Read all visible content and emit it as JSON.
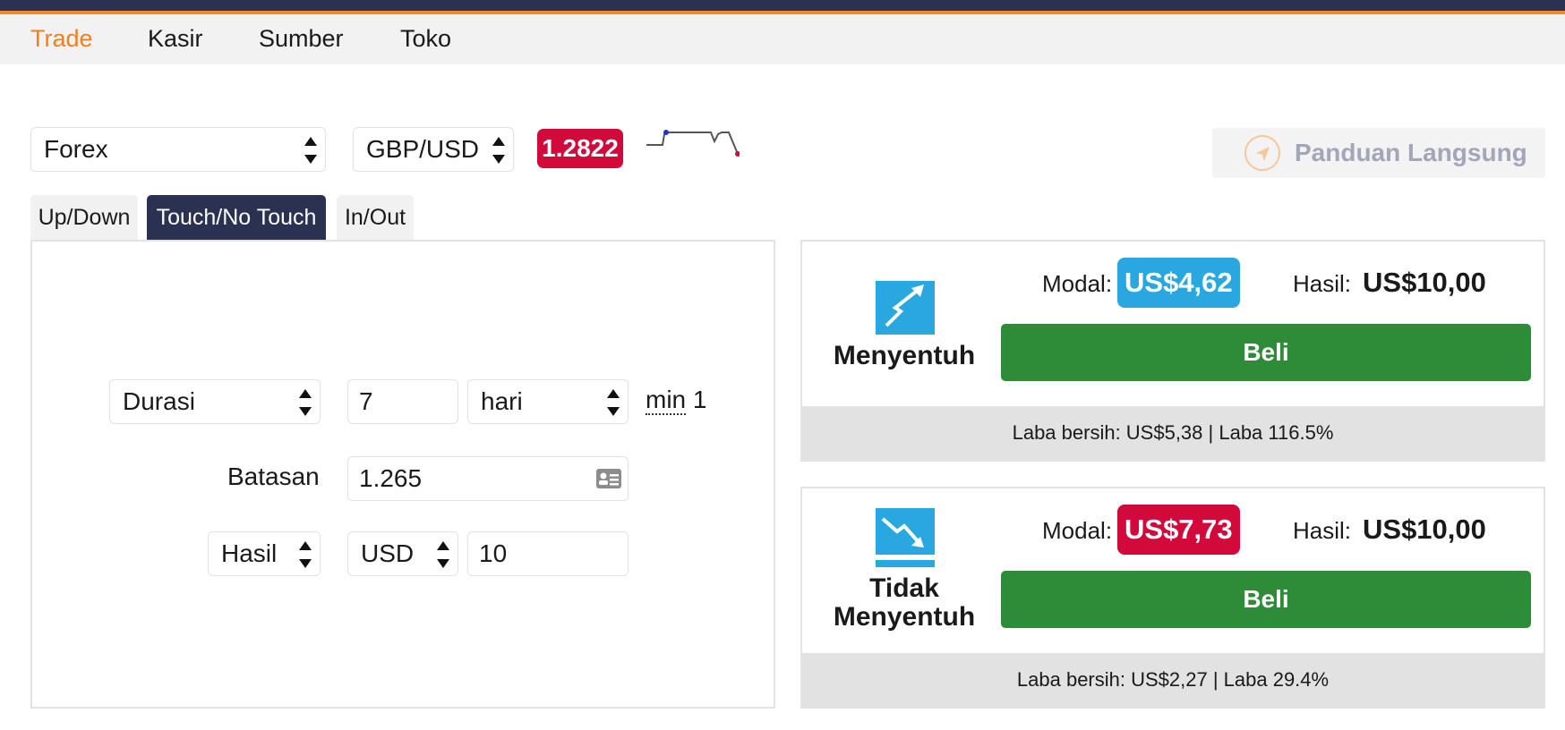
{
  "nav": {
    "items": [
      "Trade",
      "Kasir",
      "Sumber",
      "Toko"
    ],
    "active_index": 0
  },
  "controls": {
    "market_select": "Forex",
    "symbol_select": "GBP/USD",
    "spot_price": "1.2822",
    "guide_button": "Panduan Langsung"
  },
  "tabs": [
    "Up/Down",
    "Touch/No Touch",
    "In/Out"
  ],
  "active_tab": 1,
  "form": {
    "duration_type": "Durasi",
    "duration_value": "7",
    "duration_unit": "hari",
    "min_label": "min",
    "min_value": "1",
    "barrier_label": "Batasan",
    "barrier_value": "1.265",
    "payout_type": "Hasil",
    "currency": "USD",
    "amount": "10"
  },
  "contracts": [
    {
      "title_line1": "Menyentuh",
      "title_line2": "",
      "modal_label": "Modal:",
      "stake": "US$4,62",
      "stake_color": "#29a8e0",
      "payout_label": "Hasil:",
      "payout": "US$10,00",
      "buy_label": "Beli",
      "footer": "Laba bersih: US$5,38 | Laba 116.5%",
      "icon": "touch-up-icon"
    },
    {
      "title_line1": "Tidak",
      "title_line2": "Menyentuh",
      "modal_label": "Modal:",
      "stake": "US$7,73",
      "stake_color": "#d10a3b",
      "payout_label": "Hasil:",
      "payout": "US$10,00",
      "buy_label": "Beli",
      "footer": "Laba bersih: US$2,27 | Laba 29.4%",
      "icon": "no-touch-down-icon"
    }
  ],
  "colors": {
    "accent_orange": "#f07f1f",
    "navy": "#2b3150",
    "buy_green": "#2e8b37",
    "price_red": "#d10a3b"
  }
}
